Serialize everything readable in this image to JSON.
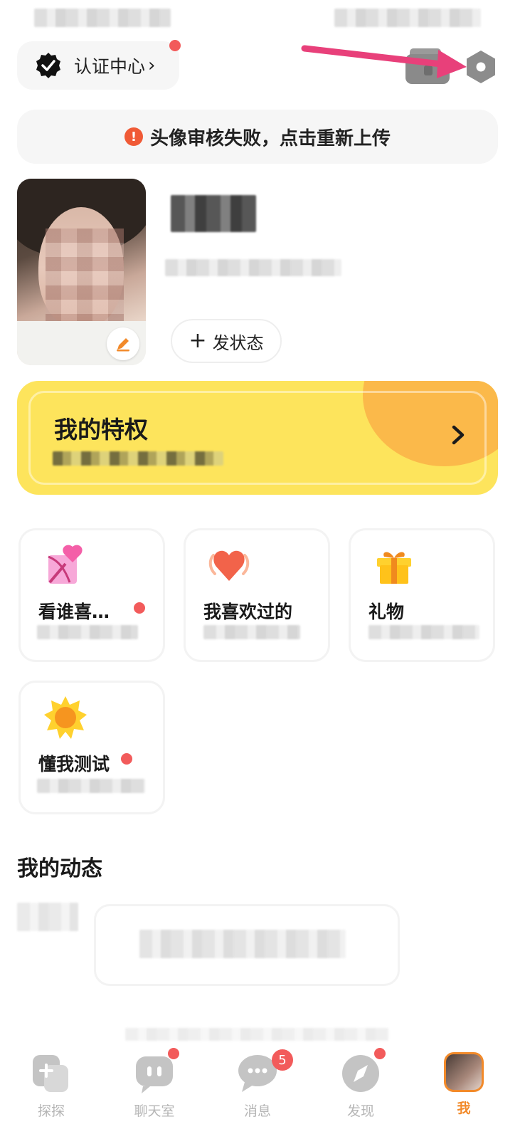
{
  "header": {
    "cert_label": "认证中心",
    "cert_chevron": "›"
  },
  "alert": {
    "icon_text": "!",
    "text": "头像审核失败，点击重新上传"
  },
  "profile": {
    "post_button_label": "发状态",
    "post_button_plus": "+"
  },
  "privilege": {
    "title": "我的特权"
  },
  "features": {
    "who_likes": {
      "title": "看谁喜…"
    },
    "i_liked": {
      "title": "我喜欢过的"
    },
    "gifts": {
      "title": "礼物"
    },
    "know_me": {
      "title": "懂我测试"
    }
  },
  "feed": {
    "title": "我的动态"
  },
  "nav": {
    "items": [
      {
        "label": "探探"
      },
      {
        "label": "聊天室"
      },
      {
        "label": "消息",
        "badge": "5"
      },
      {
        "label": "发现"
      },
      {
        "label": "我"
      }
    ]
  },
  "colors": {
    "accent": "#f28a2a",
    "alert_red": "#f05a36",
    "badge_red": "#f25b5b",
    "privilege_yellow": "#fde45c",
    "privilege_orange": "#fbb94a",
    "arrow_pink": "#e8407a"
  }
}
